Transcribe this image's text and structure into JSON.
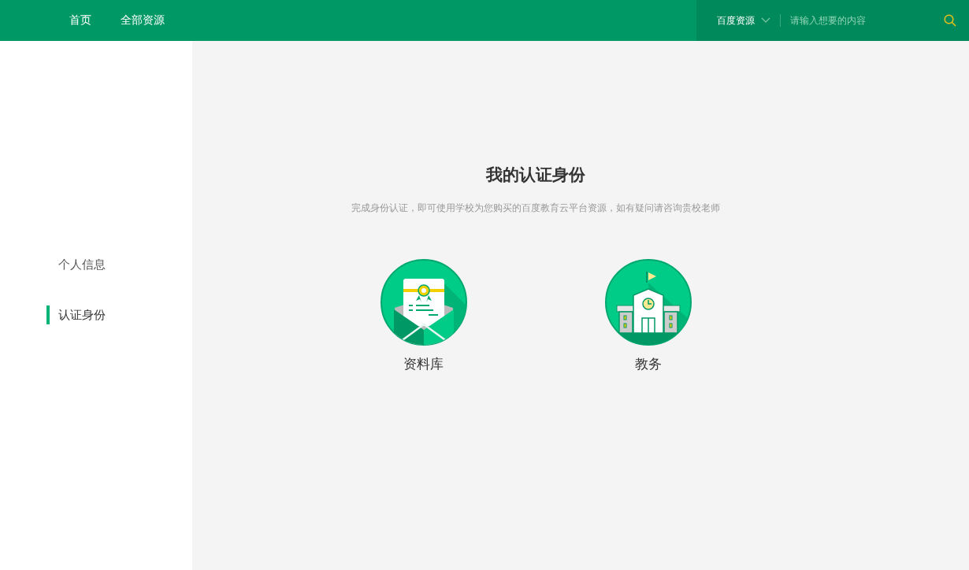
{
  "nav": {
    "links": [
      {
        "label": "首页"
      },
      {
        "label": "全部资源"
      }
    ],
    "search": {
      "scope": "百度资源",
      "placeholder": "请输入想要的内容"
    }
  },
  "sidebar": {
    "items": [
      {
        "label": "个人信息",
        "selected": false
      },
      {
        "label": "认证身份",
        "selected": true
      }
    ]
  },
  "main": {
    "title": "我的认证身份",
    "subtitle": "完成身份认证，即可使用学校为您购买的百度教育云平台资源，如有疑问请咨询贵校老师",
    "cards": [
      {
        "kind": "library",
        "label": "资料库"
      },
      {
        "kind": "academic",
        "label": "教务"
      }
    ]
  }
}
